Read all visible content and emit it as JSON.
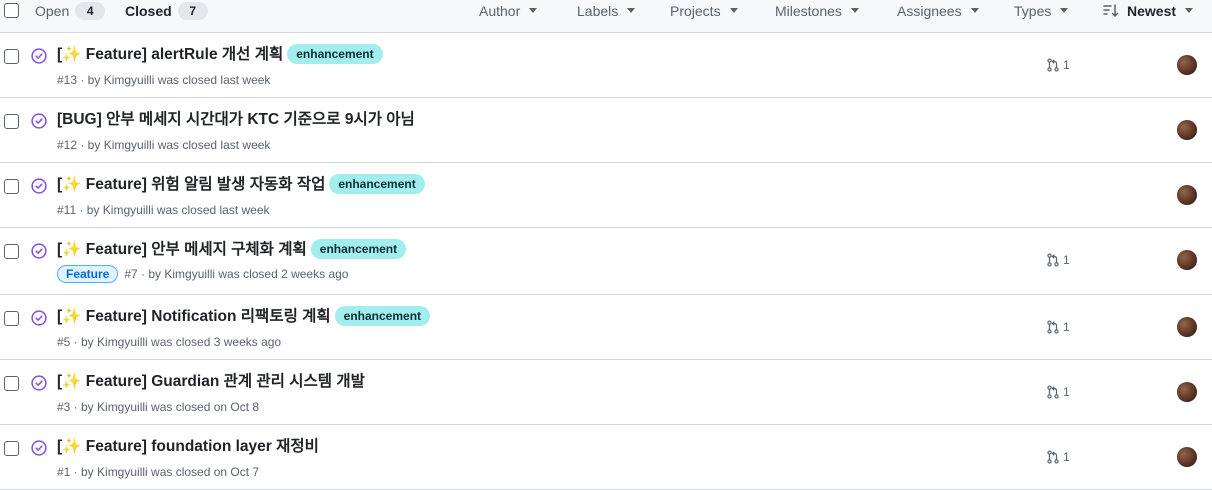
{
  "header": {
    "states": [
      {
        "label": "Open",
        "count": "4"
      },
      {
        "label": "Closed",
        "count": "7"
      }
    ],
    "filters": [
      "Author",
      "Labels",
      "Projects",
      "Milestones",
      "Assignees",
      "Types"
    ],
    "sort": "Newest"
  },
  "issues": [
    {
      "prefix": "[",
      "emoji": "✨",
      "title": " Feature] alertRule 개선 계획",
      "labels": [
        "enhancement"
      ],
      "meta": "#13 · by Kimgyuilli was closed last week",
      "linked_prs": "1"
    },
    {
      "prefix": "",
      "emoji": "",
      "title": "[BUG] 안부 메세지 시간대가 KTC 기준으로 9시가 아님",
      "labels": [],
      "meta": "#12 · by Kimgyuilli was closed last week",
      "linked_prs": ""
    },
    {
      "prefix": "[",
      "emoji": "✨",
      "title": " Feature] 위험 알림 발생 자동화 작업",
      "labels": [
        "enhancement"
      ],
      "meta": "#11 · by Kimgyuilli was closed last week",
      "linked_prs": ""
    },
    {
      "prefix": "[",
      "emoji": "✨",
      "title": " Feature] 안부 메세지 구체화 계획",
      "labels": [
        "enhancement"
      ],
      "type": "Feature",
      "meta": "#7 · by Kimgyuilli was closed 2 weeks ago",
      "linked_prs": "1"
    },
    {
      "prefix": "[",
      "emoji": "✨",
      "title": " Feature] Notification 리팩토링 계획",
      "labels": [
        "enhancement"
      ],
      "meta": "#5 · by Kimgyuilli was closed 3 weeks ago",
      "linked_prs": "1"
    },
    {
      "prefix": "[",
      "emoji": "✨",
      "title": " Feature] Guardian 관계 관리 시스템 개발",
      "labels": [],
      "meta": "#3 · by Kimgyuilli was closed on Oct 8",
      "linked_prs": "1"
    },
    {
      "prefix": "[",
      "emoji": "✨",
      "title": " Feature] foundation layer 재정비",
      "labels": [],
      "meta": "#1 · by Kimgyuilli was closed on Oct 7",
      "linked_prs": "1"
    }
  ]
}
